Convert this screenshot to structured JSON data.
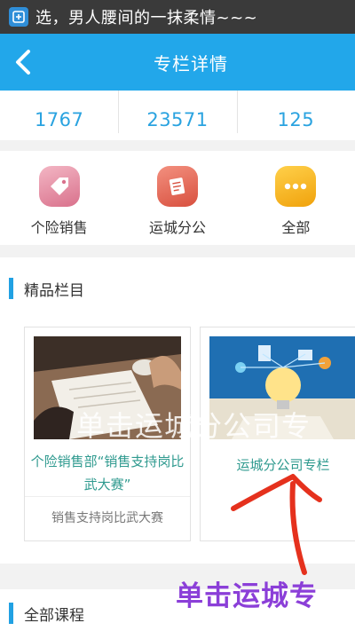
{
  "status_bar": {
    "text": "选，男人腰间的一抹柔情~~~"
  },
  "nav": {
    "title": "专栏详情"
  },
  "stats": [
    "1767",
    "23571",
    "125"
  ],
  "categories": [
    {
      "label": "个险销售",
      "icon": "tag-icon",
      "color": "#e88aa0"
    },
    {
      "label": "运城分公",
      "icon": "book-icon",
      "color": "#e86a5a"
    },
    {
      "label": "全部",
      "icon": "more-dots-icon",
      "color": "#f5b320"
    }
  ],
  "featured": {
    "title": "精品栏目",
    "cards": [
      {
        "title": "个险销售部“销售支持岗比武大赛”",
        "subtitle": "销售支持岗比武大赛"
      },
      {
        "title": "运城分公司专栏",
        "subtitle": ""
      }
    ]
  },
  "all_courses": {
    "title": "全部课程"
  },
  "annotation": {
    "banner": "单击运城分公司专",
    "caption": "单击运城专"
  },
  "colors": {
    "accent": "#22a7ea",
    "annotation": "#8b3fd8",
    "arrow": "#e5311d"
  }
}
